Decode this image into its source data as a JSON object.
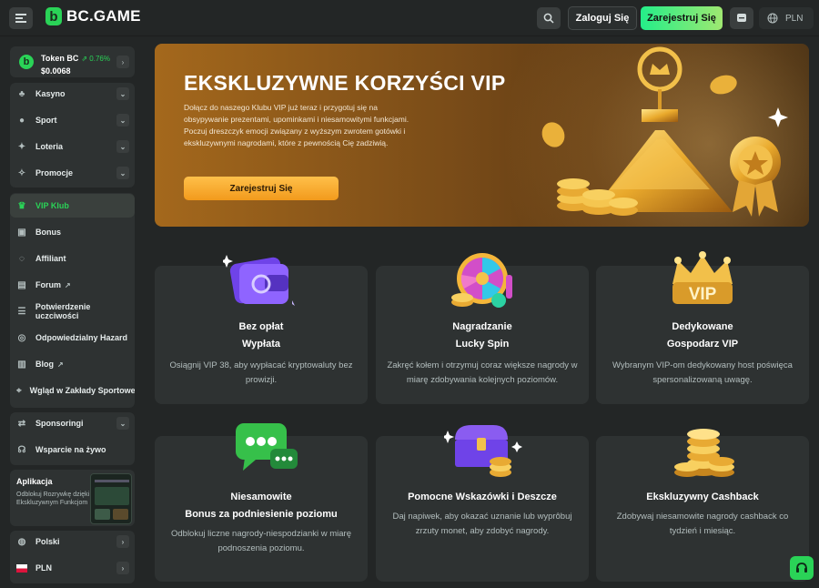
{
  "header": {
    "logo_text": "BC.GAME",
    "login_label": "Zaloguj Się",
    "register_label": "Zarejestruj Się",
    "currency": "PLN"
  },
  "sidebar": {
    "token": {
      "name": "Token BC",
      "change": "0.76%",
      "price": "$0.0068"
    },
    "groups": [
      {
        "label": "Kasyno",
        "icon": "casino-icon"
      },
      {
        "label": "Sport",
        "icon": "sport-icon"
      },
      {
        "label": "Loteria",
        "icon": "lottery-icon"
      },
      {
        "label": "Promocje",
        "icon": "promo-icon"
      }
    ],
    "items": [
      {
        "label": "VIP Klub",
        "icon": "crown-icon"
      },
      {
        "label": "Bonus",
        "icon": "gift-icon"
      },
      {
        "label": "Affiliant",
        "icon": "affiliate-icon"
      },
      {
        "label": "Forum",
        "icon": "forum-icon"
      },
      {
        "label": "Potwierdzenie uczciwości",
        "icon": "fairness-icon"
      },
      {
        "label": "Odpowiedzialny Hazard",
        "icon": "responsible-icon"
      },
      {
        "label": "Blog",
        "icon": "blog-icon"
      },
      {
        "label": "Wgląd w Zakłady Sportowe",
        "icon": "insight-icon"
      }
    ],
    "sponsoring": "Sponsoringi",
    "support": "Wsparcie na żywo",
    "app": {
      "title": "Aplikacja",
      "description": "Odblokuj Rozrywkę dzięki Ekskluzywnym Funkcjom"
    },
    "language": "Polski",
    "currency": "PLN"
  },
  "hero": {
    "title": "EKSKLUZYWNE KORZYŚCI VIP",
    "description": "Dołącz do naszego Klubu VIP już teraz i przygotuj się na obsypywanie prezentami, upominkami i niesamowitymi funkcjami. Poczuj dreszczyk emocji związany z wyższym zwrotem gotówki i ekskluzywnymi nagrodami, które z pewnością Cię zadziwią.",
    "button": "Zarejestruj Się"
  },
  "cards": [
    {
      "title1": "Bez opłat",
      "title2": "Wypłata",
      "desc": "Osiągnij VIP 38, aby wypłacać kryptowaluty bez prowizji."
    },
    {
      "title1": "Nagradzanie",
      "title2": "Lucky Spin",
      "desc": "Zakręć kołem i otrzymuj coraz większe nagrody w miarę zdobywania kolejnych poziomów."
    },
    {
      "title1": "Dedykowane",
      "title2": "Gospodarz VIP",
      "desc": "Wybranym VIP-om dedykowany host poświęca spersonalizowaną uwagę."
    },
    {
      "title1": "Niesamowite",
      "title2": "Bonus za podniesienie poziomu",
      "desc": "Odblokuj liczne nagrody-niespodzianki w miarę podnoszenia poziomu."
    },
    {
      "title1": "Pomocne Wskazówki i Deszcze",
      "title2": "",
      "desc": "Daj napiwek, aby okazać uznanie lub wyprôbuj zrzuty monet, aby zdobyć nagrody."
    },
    {
      "title1": "Ekskluzywny Cashback",
      "title2": "",
      "desc": "Zdobywaj niesamowite nagrody cashback co tydzień i miesiąc."
    }
  ],
  "art_text": {
    "vip_badge": "VIP"
  },
  "colors": {
    "accent": "#2ad357",
    "background": "#232626",
    "panel": "#2e3232",
    "gold": "#f3b23a"
  }
}
